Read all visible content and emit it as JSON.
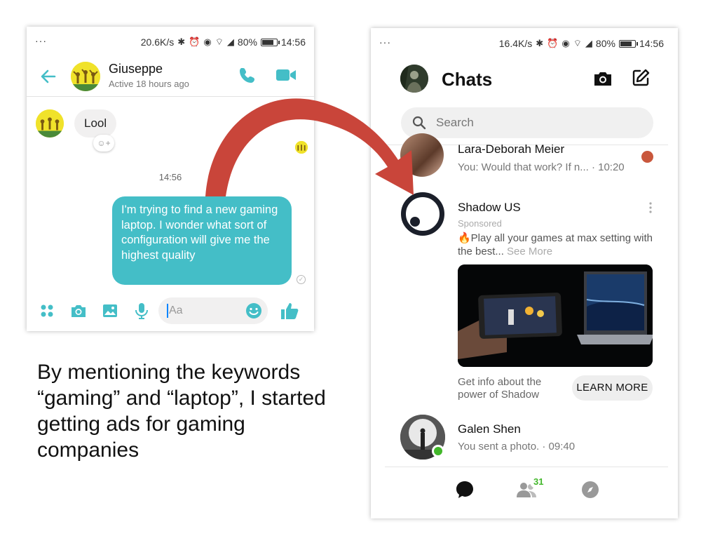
{
  "left_phone": {
    "status_bar": {
      "net_speed": "20.6K/s",
      "battery": "80%",
      "battery_level": 0.8,
      "time": "14:56"
    },
    "header": {
      "contact_name": "Giuseppe",
      "contact_status": "Active 18 hours ago"
    },
    "messages": {
      "incoming": "Lool",
      "timestamp": "14:56",
      "outgoing": "I'm trying to find a new gaming laptop. I wonder what sort of configuration will give me the highest quality"
    },
    "composer": {
      "placeholder": "Aa"
    },
    "icons": [
      "back-arrow-icon",
      "phone-icon",
      "video-icon",
      "apps-icon",
      "camera-icon",
      "image-icon",
      "mic-icon",
      "emoji-icon",
      "like-icon"
    ],
    "accent_color": "#44bec7"
  },
  "right_phone": {
    "status_bar": {
      "net_speed": "16.4K/s",
      "battery": "80%",
      "battery_level": 0.8,
      "time": "14:56"
    },
    "title": "Chats",
    "search": {
      "placeholder": "Search"
    },
    "conversations": [
      {
        "name": "Lara-Deborah Meier",
        "preview": "You: Would that work? If n... · 10:20"
      },
      {
        "name": "Galen Shen",
        "preview": "You sent a photo. · 09:40",
        "online": true
      }
    ],
    "ad": {
      "name": "Shadow US",
      "sponsored": "Sponsored",
      "text": "🔥Play all your games at max setting with the best...",
      "see_more": "See More",
      "caption": "Get info about the power of Shadow",
      "cta": "LEARN MORE"
    },
    "tabbar": {
      "people_badge": "31"
    },
    "online_color": "#42b72a"
  },
  "annotation": {
    "caption": "By mentioning the keywords “gaming” and “laptop”, I started getting ads for gaming companies",
    "arrow_color": "#c9453a"
  }
}
